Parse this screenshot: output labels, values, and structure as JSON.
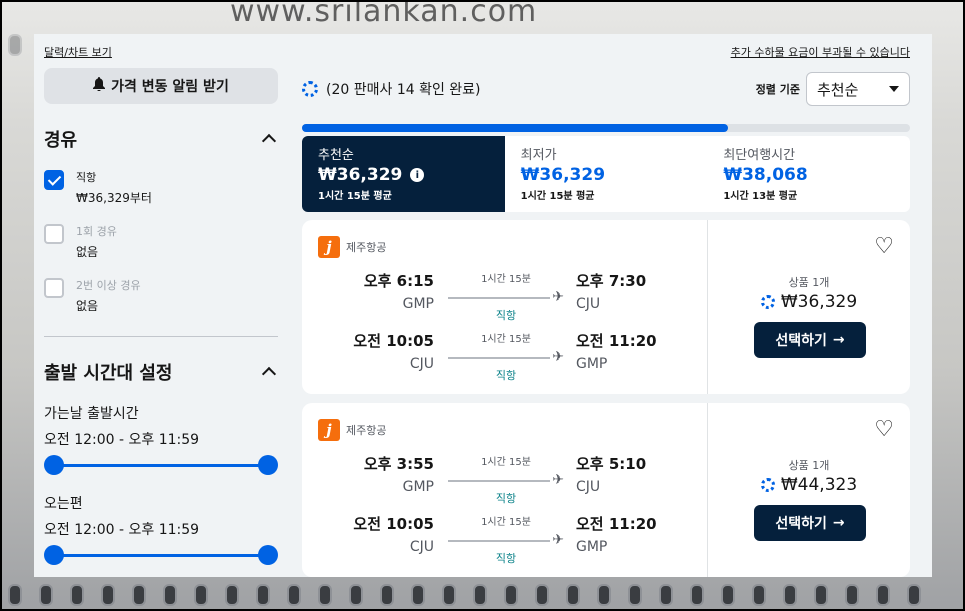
{
  "background_text": "www.srilankan.com",
  "top_links": {
    "chart": "달력/차트 보기",
    "fees": "추가 수하물 요금이 부과될 수 있습니다"
  },
  "left": {
    "alert_button": "가격 변동 알림 받기",
    "stops_title": "경유",
    "stops": [
      {
        "label": "직항",
        "sub": "₩36,329부터",
        "checked": true
      },
      {
        "label": "1회 경유",
        "sub": "없음",
        "checked": false
      },
      {
        "label": "2번 이상 경유",
        "sub": "없음",
        "checked": false
      }
    ],
    "time_title": "출발 시간대 설정",
    "outbound": {
      "label": "가는날 출발시간",
      "range": "오전 12:00 - 오후 11:59"
    },
    "inbound": {
      "label": "오는편",
      "range": "오전 12:00 - 오후 11:59"
    }
  },
  "status": "(20 판매사 14 확인 완료)",
  "progress": 0.7,
  "sort": {
    "label": "정렬 기준",
    "value": "추천순"
  },
  "tabs": [
    {
      "name": "추천순",
      "price": "₩36,329",
      "avg": "1시간 15분 평균",
      "active": true
    },
    {
      "name": "최저가",
      "price": "₩36,329",
      "avg": "1시간 15분 평균",
      "active": false
    },
    {
      "name": "최단여행시간",
      "price": "₩38,068",
      "avg": "1시간 13분 평균",
      "active": false
    }
  ],
  "results": [
    {
      "airline": "제주항공",
      "airline_logo": "j",
      "legs": [
        {
          "dep_time": "오후 6:15",
          "dep_code": "GMP",
          "duration": "1시간 15분",
          "stops": "직항",
          "arr_time": "오후 7:30",
          "arr_code": "CJU"
        },
        {
          "dep_time": "오전 10:05",
          "dep_code": "CJU",
          "duration": "1시간 15분",
          "stops": "직항",
          "arr_time": "오전 11:20",
          "arr_code": "GMP"
        }
      ],
      "deals": "상품 1개",
      "price": "₩36,329",
      "select": "선택하기"
    },
    {
      "airline": "제주항공",
      "airline_logo": "j",
      "legs": [
        {
          "dep_time": "오후 3:55",
          "dep_code": "GMP",
          "duration": "1시간 15분",
          "stops": "직항",
          "arr_time": "오후 5:10",
          "arr_code": "CJU"
        },
        {
          "dep_time": "오전 10:05",
          "dep_code": "CJU",
          "duration": "1시간 15분",
          "stops": "직항",
          "arr_time": "오전 11:20",
          "arr_code": "GMP"
        }
      ],
      "deals": "상품 1개",
      "price": "₩44,323",
      "select": "선택하기"
    }
  ],
  "colors": {
    "accent": "#0062e3",
    "navy": "#05203c",
    "direct": "#0c838a",
    "airline": "#f56e0d"
  }
}
